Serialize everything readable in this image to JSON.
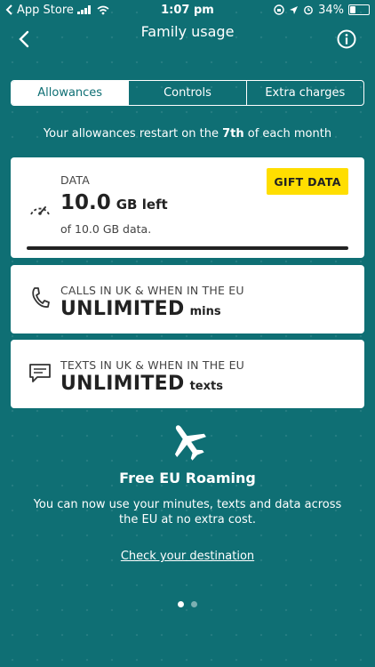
{
  "status_bar": {
    "back_app": "App Store",
    "time": "1:07 pm",
    "battery": "34%",
    "battery_level": 0.34
  },
  "nav": {
    "title": "Family usage"
  },
  "tabs": [
    {
      "label": "Allowances",
      "active": true
    },
    {
      "label": "Controls",
      "active": false
    },
    {
      "label": "Extra charges",
      "active": false
    }
  ],
  "restart": {
    "prefix": "Your allowances restart on the ",
    "day": "7th",
    "suffix": " of each month"
  },
  "data_card": {
    "label": "DATA",
    "amount": "10.0",
    "unit": "GB left",
    "of_text": "of 10.0 GB data.",
    "gift_label": "GIFT DATA",
    "remaining_fraction": 1.0
  },
  "calls_card": {
    "label": "CALLS IN UK & WHEN IN THE EU",
    "value": "UNLIMITED",
    "unit": "mins"
  },
  "texts_card": {
    "label": "TEXTS IN UK & WHEN IN THE EU",
    "value": "UNLIMITED",
    "unit": "texts"
  },
  "roaming": {
    "title": "Free EU Roaming",
    "text": "You can now use your minutes, texts and data across the EU at no extra cost.",
    "link": "Check your destination"
  },
  "pager": {
    "pages": 2,
    "current": 1
  },
  "colors": {
    "background": "#0f6f74",
    "gift_button": "#ffde00"
  }
}
